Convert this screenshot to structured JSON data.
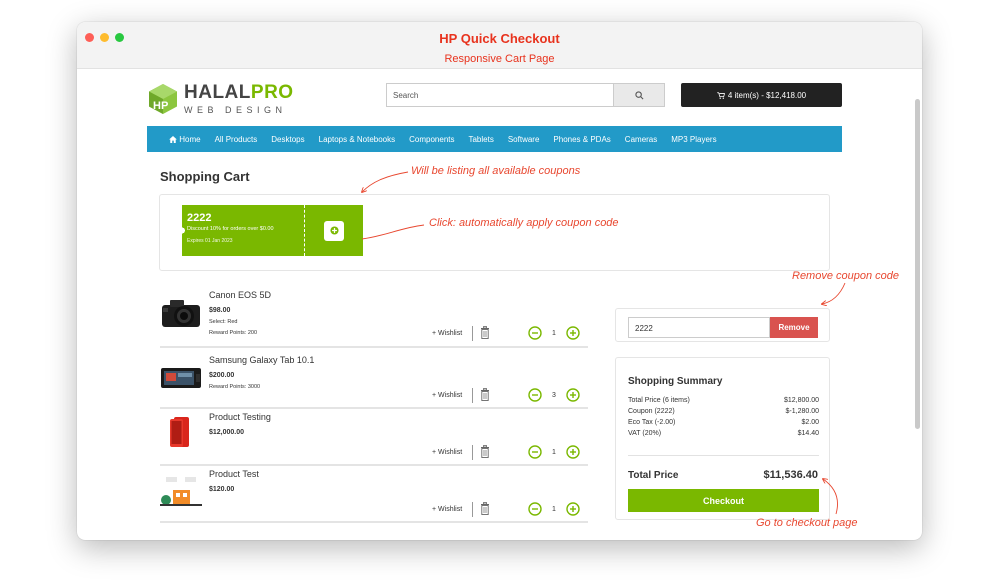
{
  "window": {
    "title": "HP Quick Checkout",
    "subtitle": "Responsive Cart Page"
  },
  "header": {
    "logo_top": "HALALPRO",
    "logo_bottom": "WEB DESIGN",
    "search_placeholder": "Search",
    "cart_label": "4 item(s) - $12,418.00"
  },
  "nav": {
    "items": [
      "Home",
      "All Products",
      "Desktops",
      "Laptops & Notebooks",
      "Components",
      "Tablets",
      "Software",
      "Phones & PDAs",
      "Cameras",
      "MP3 Players"
    ]
  },
  "page": {
    "heading": "Shopping Cart"
  },
  "coupon": {
    "code": "2222",
    "description": "Discount 10% for orders over $0.00",
    "expires": "Expires 01 Jan 2023"
  },
  "annotations": {
    "listing": "Will be listing all available coupons",
    "apply": "Click: automatically apply coupon code",
    "remove": "Remove coupon code",
    "checkout": "Go to checkout page"
  },
  "cart": {
    "wishlist_label": "+ Wishlist",
    "items": [
      {
        "name": "Canon EOS 5D",
        "price": "$98.00",
        "option": "Select: Red",
        "reward": "Reward Points: 200",
        "qty": "1"
      },
      {
        "name": "Samsung Galaxy Tab 10.1",
        "price": "$200.00",
        "reward": "Reward Points: 3000",
        "qty": "3"
      },
      {
        "name": "Product Testing",
        "price": "$12,000.00",
        "qty": "1"
      },
      {
        "name": "Product Test",
        "price": "$120.00",
        "qty": "1"
      }
    ]
  },
  "coupon_form": {
    "value": "2222",
    "remove_label": "Remove"
  },
  "summary": {
    "title": "Shopping Summary",
    "rows": [
      {
        "label": "Total Price (6 items)",
        "value": "$12,800.00"
      },
      {
        "label": "Coupon (2222)",
        "value": "$-1,280.00"
      },
      {
        "label": "Eco Tax (-2.00)",
        "value": "$2.00"
      },
      {
        "label": "VAT (20%)",
        "value": "$14.40"
      }
    ],
    "total_label": "Total Price",
    "total_value": "$11,536.40",
    "checkout_label": "Checkout"
  },
  "colors": {
    "accent_green": "#7ab800",
    "nav_blue": "#229ac8",
    "remove_red": "#d9534f",
    "annotation_red": "#e8472f"
  }
}
